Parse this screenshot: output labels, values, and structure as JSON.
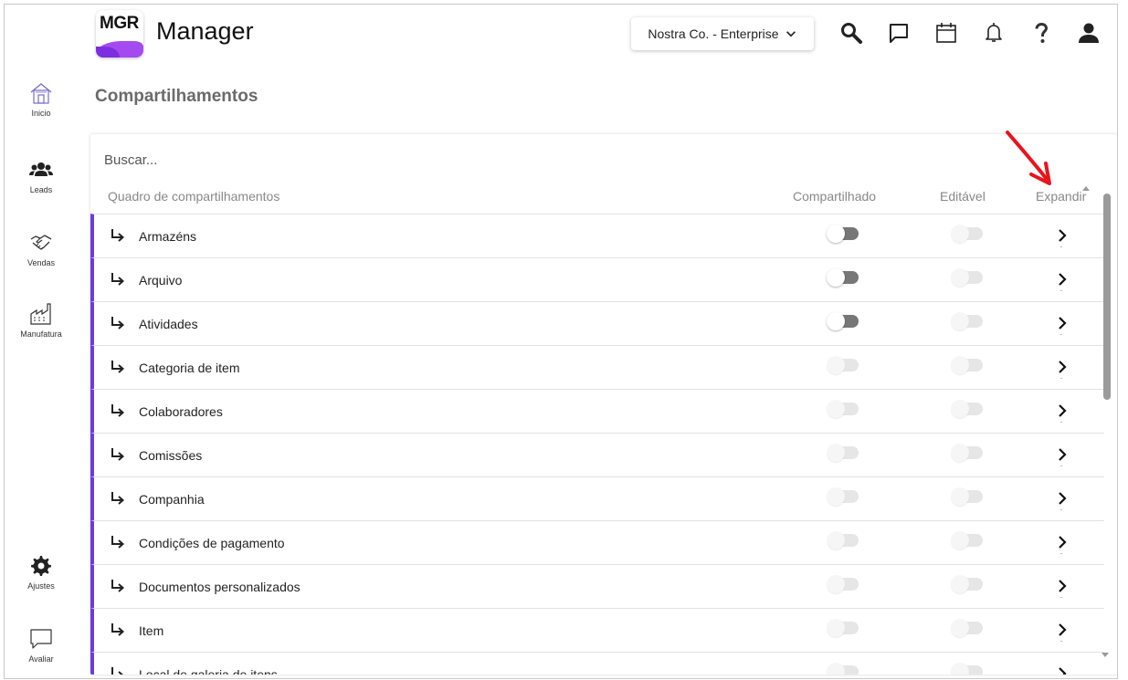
{
  "header": {
    "logo_text": "MGR",
    "app_title": "Manager",
    "company_selector": "Nostra Co. - Enterprise",
    "icons": [
      "search-icon",
      "chat-icon",
      "calendar-icon",
      "bell-icon",
      "help-icon",
      "user-icon"
    ]
  },
  "sidebar": {
    "items": [
      {
        "label": "Inicio",
        "icon": "home-icon"
      },
      {
        "label": "Leads",
        "icon": "people-icon"
      },
      {
        "label": "Vendas",
        "icon": "handshake-icon"
      },
      {
        "label": "Manufatura",
        "icon": "factory-icon"
      },
      {
        "label": "Ajustes",
        "icon": "gear-icon"
      },
      {
        "label": "Avaliar",
        "icon": "feedback-icon"
      }
    ]
  },
  "page": {
    "title": "Compartilhamentos"
  },
  "table": {
    "search_placeholder": "Buscar...",
    "columns": {
      "name": "Quadro de compartilhamentos",
      "shared": "Compartilhado",
      "editable": "Editável",
      "expand": "Expandir"
    },
    "rows": [
      {
        "label": "Armazéns",
        "shared": false,
        "shared_enabled": true,
        "editable": false
      },
      {
        "label": "Arquivo",
        "shared": false,
        "shared_enabled": true,
        "editable": false
      },
      {
        "label": "Atividades",
        "shared": false,
        "shared_enabled": true,
        "editable": false
      },
      {
        "label": "Categoria de item",
        "shared": false,
        "shared_enabled": false,
        "editable": false
      },
      {
        "label": "Colaboradores",
        "shared": false,
        "shared_enabled": false,
        "editable": false
      },
      {
        "label": "Comissões",
        "shared": false,
        "shared_enabled": false,
        "editable": false
      },
      {
        "label": "Companhia",
        "shared": false,
        "shared_enabled": false,
        "editable": false
      },
      {
        "label": "Condições de pagamento",
        "shared": false,
        "shared_enabled": false,
        "editable": false
      },
      {
        "label": "Documentos personalizados",
        "shared": false,
        "shared_enabled": false,
        "editable": false
      },
      {
        "label": "Item",
        "shared": false,
        "shared_enabled": false,
        "editable": false
      },
      {
        "label": "Local de galeria de itens",
        "shared": false,
        "shared_enabled": false,
        "editable": false
      }
    ]
  },
  "colors": {
    "accent": "#6a3ce2",
    "logo_purple": "#a44bf0",
    "annotation_red": "#e8141c"
  }
}
